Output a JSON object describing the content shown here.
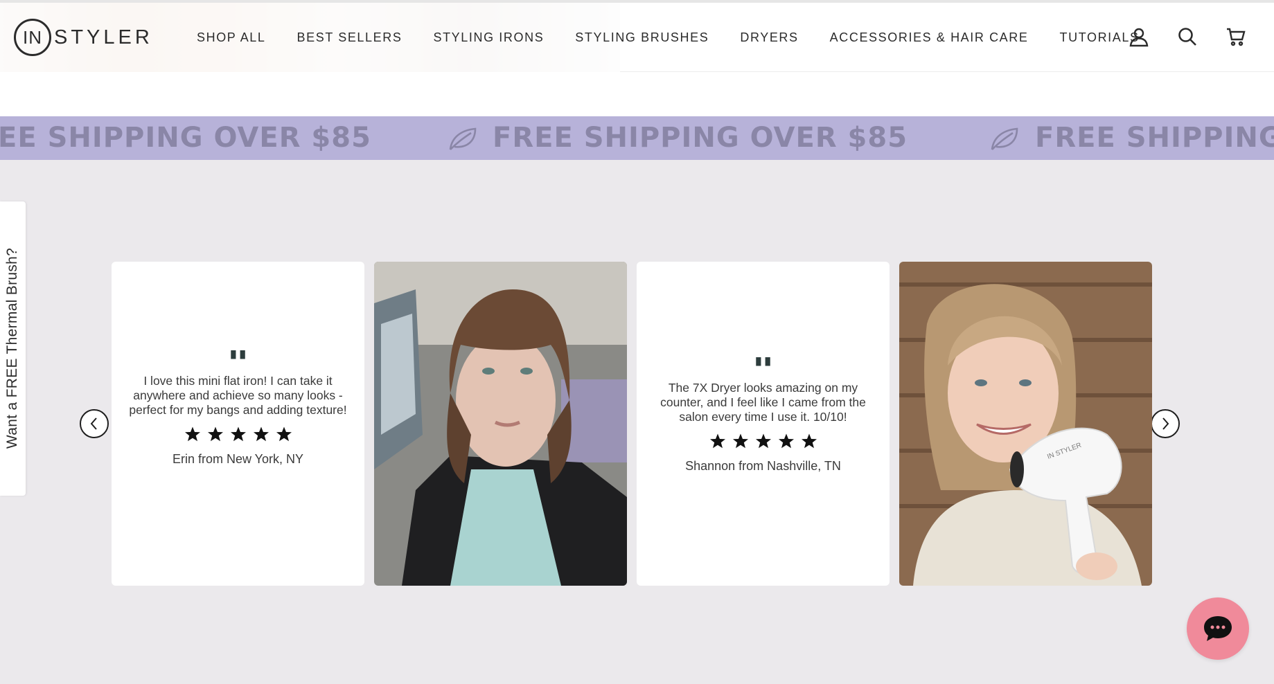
{
  "header": {
    "logo": {
      "mark": "IN",
      "text": "STYLER"
    },
    "nav": [
      {
        "label": "SHOP ALL"
      },
      {
        "label": "BEST SELLERS"
      },
      {
        "label": "STYLING IRONS"
      },
      {
        "label": "STYLING BRUSHES"
      },
      {
        "label": "DRYERS"
      },
      {
        "label": "ACCESSORIES & HAIR CARE"
      },
      {
        "label": "TUTORIALS"
      }
    ],
    "icons": [
      "account-icon",
      "search-icon",
      "cart-icon"
    ]
  },
  "shipping_banner": {
    "repeats": [
      "EE SHIPPING OVER $85",
      "FREE SHIPPING OVER $85",
      "FREE SHIPPING O"
    ],
    "background": "#b7b2d9",
    "text_color": "#8a86a7"
  },
  "side_tab": {
    "label": "Want a FREE Thermal Brush?"
  },
  "reviews": [
    {
      "text": "I love this mini flat iron! I can take it anywhere and achieve so many looks - perfect for my bangs and adding texture!",
      "rating": 5,
      "author": "Erin from New York, NY"
    },
    {
      "text": "The 7X Dryer looks amazing on my counter, and I feel like I came from the salon every time I use it. 10/10!",
      "rating": 5,
      "author": "Shannon from Nashville, TN"
    }
  ],
  "photo_cards": [
    {
      "alt": "woman with bangs selfie in car"
    },
    {
      "alt": "woman holding white hair dryer",
      "product_mark": "IN STYLER"
    }
  ],
  "quote_mark": "\"",
  "carousel": {
    "prev_icon": "chevron-left-icon",
    "next_icon": "chevron-right-icon"
  },
  "chat": {
    "icon": "chat-bubble-icon",
    "color": "#f08a9a"
  }
}
